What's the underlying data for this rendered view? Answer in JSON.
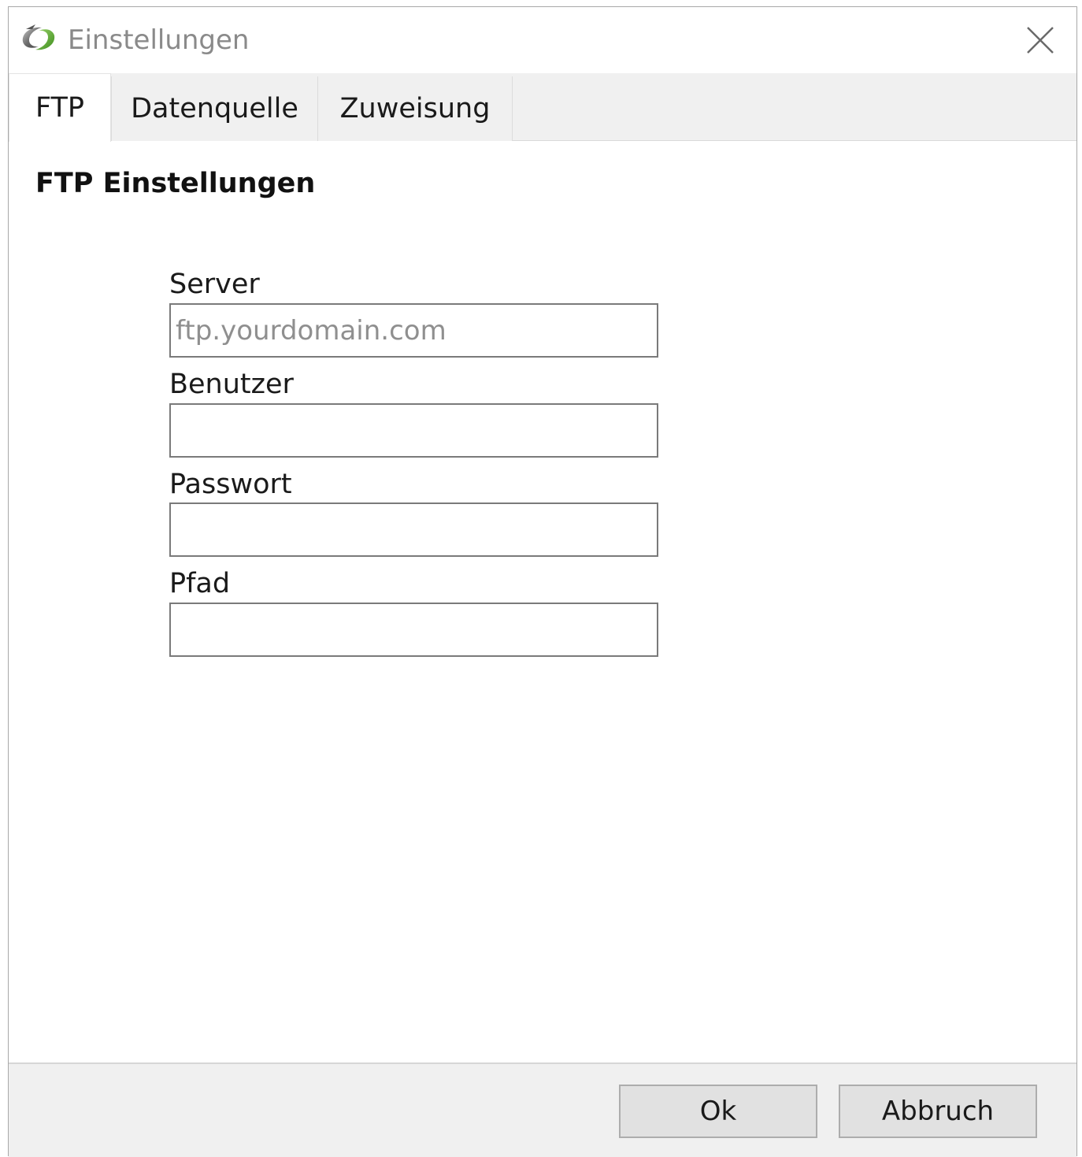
{
  "window": {
    "title": "Einstellungen",
    "icon": "app-logo-icon",
    "close_icon": "close-icon"
  },
  "tabs": [
    {
      "label": "FTP",
      "active": true
    },
    {
      "label": "Datenquelle",
      "active": false
    },
    {
      "label": "Zuweisung",
      "active": false
    }
  ],
  "ftp": {
    "section_title": "FTP Einstellungen",
    "fields": {
      "server": {
        "label": "Server",
        "value": "",
        "placeholder": "ftp.yourdomain.com"
      },
      "user": {
        "label": "Benutzer",
        "value": "",
        "placeholder": ""
      },
      "password": {
        "label": "Passwort",
        "value": "",
        "placeholder": ""
      },
      "path": {
        "label": "Pfad",
        "value": "",
        "placeholder": ""
      }
    }
  },
  "footer": {
    "ok_label": "Ok",
    "cancel_label": "Abbruch"
  },
  "colors": {
    "title_text": "#8a8a8a",
    "tabstrip_bg": "#f0f0f0",
    "button_bg": "#e1e1e1",
    "icon_green": "#5fae2e"
  }
}
